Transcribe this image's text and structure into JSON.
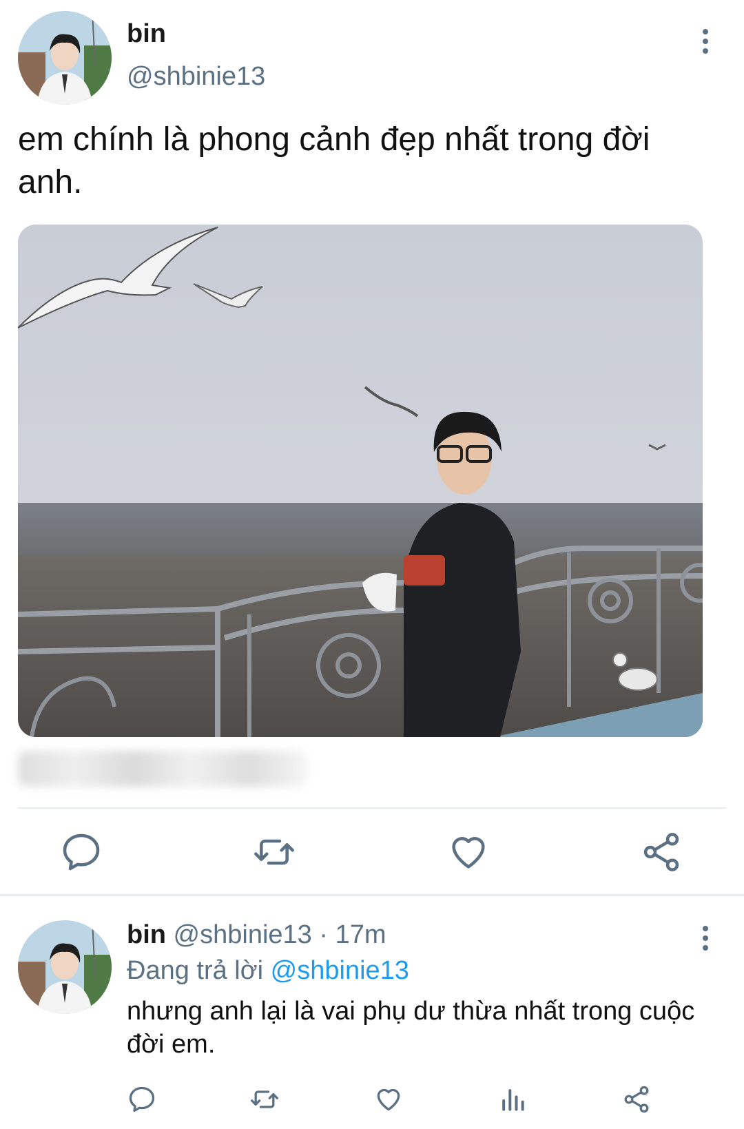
{
  "tweet": {
    "author_name": "bin",
    "author_handle": "@shbinie13",
    "text": "em chính là phong cảnh đẹp nhất trong đời anh.",
    "actions": [
      "reply-icon",
      "retweet-icon",
      "like-icon",
      "share-icon"
    ]
  },
  "reply": {
    "author_name": "bin",
    "author_handle": "@shbinie13",
    "separator": " · ",
    "time": "17m",
    "replying_prefix": "Đang trả lời",
    "replying_to": "@shbinie13",
    "text": "nhưng anh lại là vai phụ dư thừa nhất trong cuộc đời em.",
    "actions": [
      "reply-icon",
      "retweet-icon",
      "like-icon",
      "analytics-icon",
      "share-icon"
    ]
  },
  "colors": {
    "icon": "#5b7083",
    "mention": "#1d9bf0",
    "divider": "#e6ecf0"
  }
}
